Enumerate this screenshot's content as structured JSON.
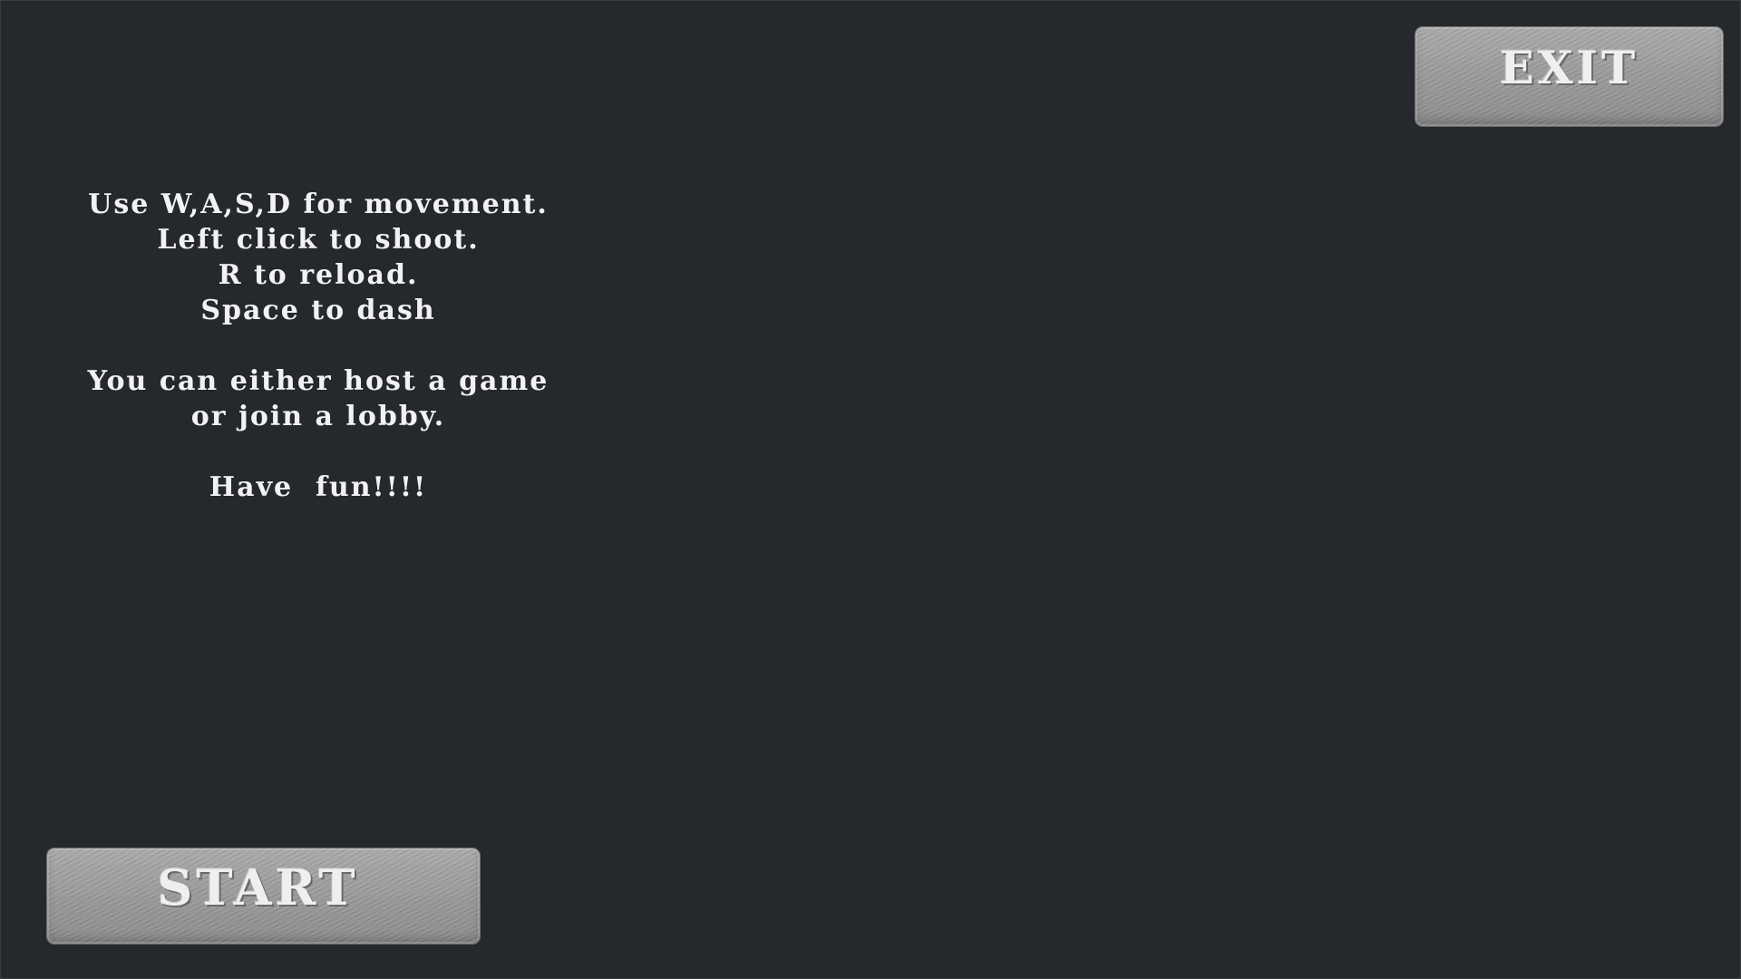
{
  "buttons": {
    "exit_label": "EXIT",
    "start_label": "START"
  },
  "instructions": {
    "lines": [
      "Use W,A,S,D for movement.",
      "Left click to shoot.",
      "R to reload.",
      "Space to dash",
      "You can either host a game",
      "or join a lobby.",
      "Have  fun!!!!"
    ]
  },
  "colors": {
    "background": "#25282d",
    "button_fill": "#9a9a9a",
    "text": "#f2f2f2"
  }
}
